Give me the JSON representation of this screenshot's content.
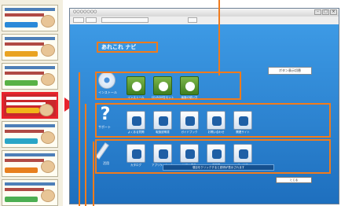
{
  "window": {
    "title": "○○○○○○○"
  },
  "app": {
    "title": "あれこれ ナビ"
  },
  "top_right_button": "ボタン表示切替",
  "sections": [
    {
      "id": "cd",
      "label": "インストール",
      "tiles": [
        {
          "label": "インストール",
          "style": "green"
        },
        {
          "label": "CD-ROMをセット",
          "style": "green"
        },
        {
          "label": "画面の使い方",
          "style": "green"
        }
      ]
    },
    {
      "id": "help",
      "label": "サポート",
      "tiles": [
        {
          "label": "よくある質問",
          "style": "blue"
        },
        {
          "label": "取扱説明書",
          "style": "blue"
        },
        {
          "label": "ガイドブック",
          "style": "blue"
        },
        {
          "label": "お問い合わせ",
          "style": "blue"
        },
        {
          "label": "関連サイト",
          "style": "blue"
        }
      ]
    },
    {
      "id": "memo",
      "label": "活用",
      "tiles": [
        {
          "label": "カタログ",
          "style": "blue"
        },
        {
          "label": "アプリケーション",
          "style": "blue"
        },
        {
          "label": "ソフト紹介",
          "style": "blue"
        },
        {
          "label": "活用例",
          "style": "blue"
        },
        {
          "label": "サービス",
          "style": "blue"
        }
      ]
    }
  ],
  "message": "項目をクリックすると説明が表示されます",
  "ok_button": "とじる",
  "promo_items": [
    {
      "text": "初心者ガイド",
      "band": "#2a8ad8",
      "selected": false
    },
    {
      "text": "困ったときは",
      "band": "#e9a321",
      "selected": false
    },
    {
      "text": "使い方ガイド",
      "band": "#59b246",
      "selected": false
    },
    {
      "text": "あれこれナビ",
      "band": "#f1b51a",
      "selected": true
    },
    {
      "text": "よくある質問",
      "band": "#2aa5c7",
      "selected": false
    },
    {
      "text": "便利な使い方",
      "band": "#e77f1e",
      "selected": false
    },
    {
      "text": "サポート情報",
      "band": "#4cae52",
      "selected": false
    }
  ],
  "colors": {
    "accent": "#f07b1c",
    "highlight": "#e8232b",
    "window_bg": "#2e86d3"
  }
}
